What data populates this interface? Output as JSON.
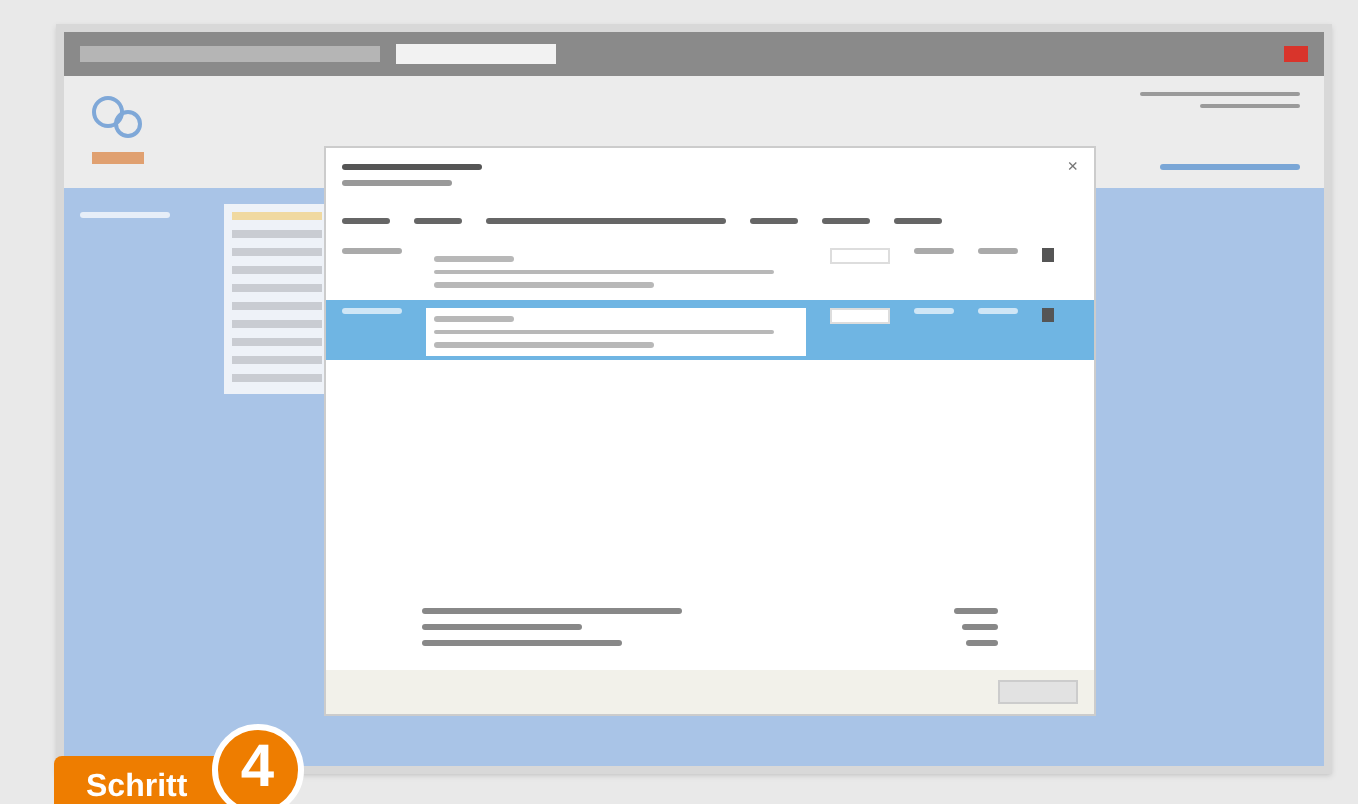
{
  "dialog": {
    "close": "×",
    "columns": [
      {
        "kind": "short"
      },
      {
        "kind": "short"
      },
      {
        "kind": "wide"
      },
      {
        "kind": "short"
      },
      {
        "kind": "short"
      },
      {
        "kind": "short"
      }
    ],
    "rows": [
      {
        "selected": false
      },
      {
        "selected": true
      }
    ]
  },
  "submenu": [
    {
      "selected": true
    },
    {
      "selected": false
    },
    {
      "selected": false
    },
    {
      "selected": false
    },
    {
      "selected": false
    },
    {
      "selected": false
    },
    {
      "selected": false
    },
    {
      "selected": false
    },
    {
      "selected": false
    },
    {
      "selected": false
    }
  ],
  "badge": {
    "label": "Schritt",
    "number": "4"
  }
}
